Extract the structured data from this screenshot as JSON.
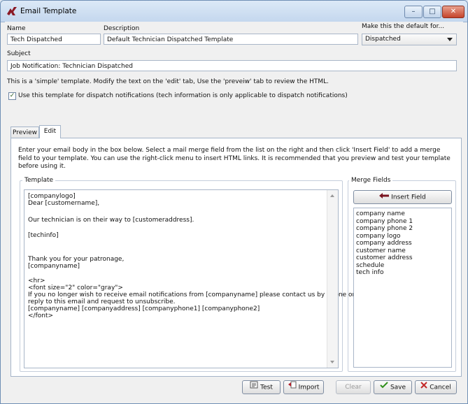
{
  "window": {
    "title": "Email Template"
  },
  "fields": {
    "name_label": "Name",
    "name_value": "Tech Dispatched",
    "description_label": "Description",
    "description_value": "Default Technician Dispatched Template",
    "default_label": "Make this the default for...",
    "default_value": "Dispatched",
    "subject_label": "Subject",
    "subject_value": "Job Notification: Technician Dispatched"
  },
  "info_text": "This is a 'simple' template.  Modify the text on the 'edit' tab, Use the 'preveiw' tab to review the HTML.",
  "dispatch_checkbox": {
    "label": "Use this template for dispatch notifications (tech information is only applicable to dispatch notifications)",
    "checked": true,
    "mark": "✓"
  },
  "tabs": [
    {
      "label": "Preview",
      "active": false
    },
    {
      "label": "Edit",
      "active": true
    }
  ],
  "instructions": "Enter your email body in the box below.  Select a mail merge field from the list on the right and then click 'Insert Field' to add a merge field to your template.  You can use the right-click menu to insert HTML links.  It is recommended that you preview and test your template before using it.",
  "template": {
    "label": "Template",
    "lines": [
      "[companylogo]",
      "Dear [customername],",
      "",
      "Our technician is on their way to [customeraddress].",
      "",
      "[techinfo]",
      "",
      "",
      "",
      "Thank you for your patronage,",
      "[companyname]",
      "",
      "<hr>",
      "<font size=\"2\" color=\"gray\">",
      "If you no longer wish to receive email notifications from [companyname] please contact us by phone or",
      "reply to this email and request to unsubscribe.",
      "[companyname] [companyaddress] [companyphone1] [companyphone2]",
      "</font>"
    ]
  },
  "merge_fields": {
    "label": "Merge Fields",
    "insert_button": "Insert Field",
    "items": [
      "company name",
      "company phone 1",
      "company phone 2",
      "company logo",
      "company address",
      "customer name",
      "customer address",
      "schedule",
      "tech info"
    ]
  },
  "buttons": {
    "test": "Test",
    "import": "Import",
    "clear": "Clear",
    "save": "Save",
    "cancel": "Cancel"
  },
  "icons": {
    "app": "dispatch-logo-icon",
    "minimize": "minimize-icon",
    "maximize": "maximize-icon",
    "close": "close-icon",
    "insert": "arrow-left-icon",
    "test": "test-email-icon",
    "import": "import-icon",
    "save": "checkmark-icon",
    "cancel": "x-icon"
  },
  "window_controls": {
    "minimize": "–",
    "maximize": "□",
    "close": "✕"
  },
  "colors": {
    "accent": "#7a1420",
    "save": "#2f8f1b",
    "cancel": "#c22828"
  }
}
